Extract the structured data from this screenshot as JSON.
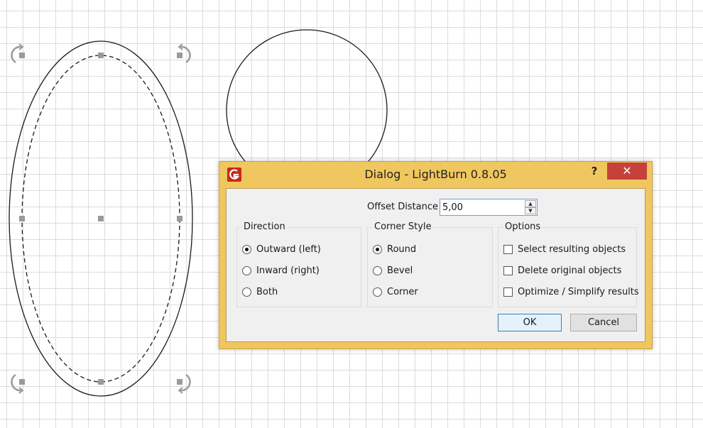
{
  "dialog": {
    "title": "Dialog - LightBurn 0.8.05",
    "help_label": "?",
    "close_label": "✕",
    "offset": {
      "label": "Offset Distance",
      "value": "5,00"
    },
    "direction": {
      "title": "Direction",
      "options": [
        {
          "label": "Outward (left)",
          "checked": true
        },
        {
          "label": "Inward (right)",
          "checked": false
        },
        {
          "label": "Both",
          "checked": false
        }
      ]
    },
    "corner_style": {
      "title": "Corner Style",
      "options": [
        {
          "label": "Round",
          "checked": true
        },
        {
          "label": "Bevel",
          "checked": false
        },
        {
          "label": "Corner",
          "checked": false
        }
      ]
    },
    "options": {
      "title": "Options",
      "items": [
        {
          "label": "Select resulting objects",
          "checked": false
        },
        {
          "label": "Delete original objects",
          "checked": false
        },
        {
          "label": "Optimize / Simplify results",
          "checked": false
        }
      ]
    },
    "ok_label": "OK",
    "cancel_label": "Cancel"
  },
  "colors": {
    "dialog_frame": "#f0c75e",
    "close_button": "#c7413b",
    "app_icon": "#c8291c",
    "grid": "#dcdcdc"
  },
  "icons": [
    "lightburn-app-icon",
    "rotate-handle-icon",
    "resize-handle-icon",
    "spin-up-icon",
    "spin-down-icon"
  ]
}
